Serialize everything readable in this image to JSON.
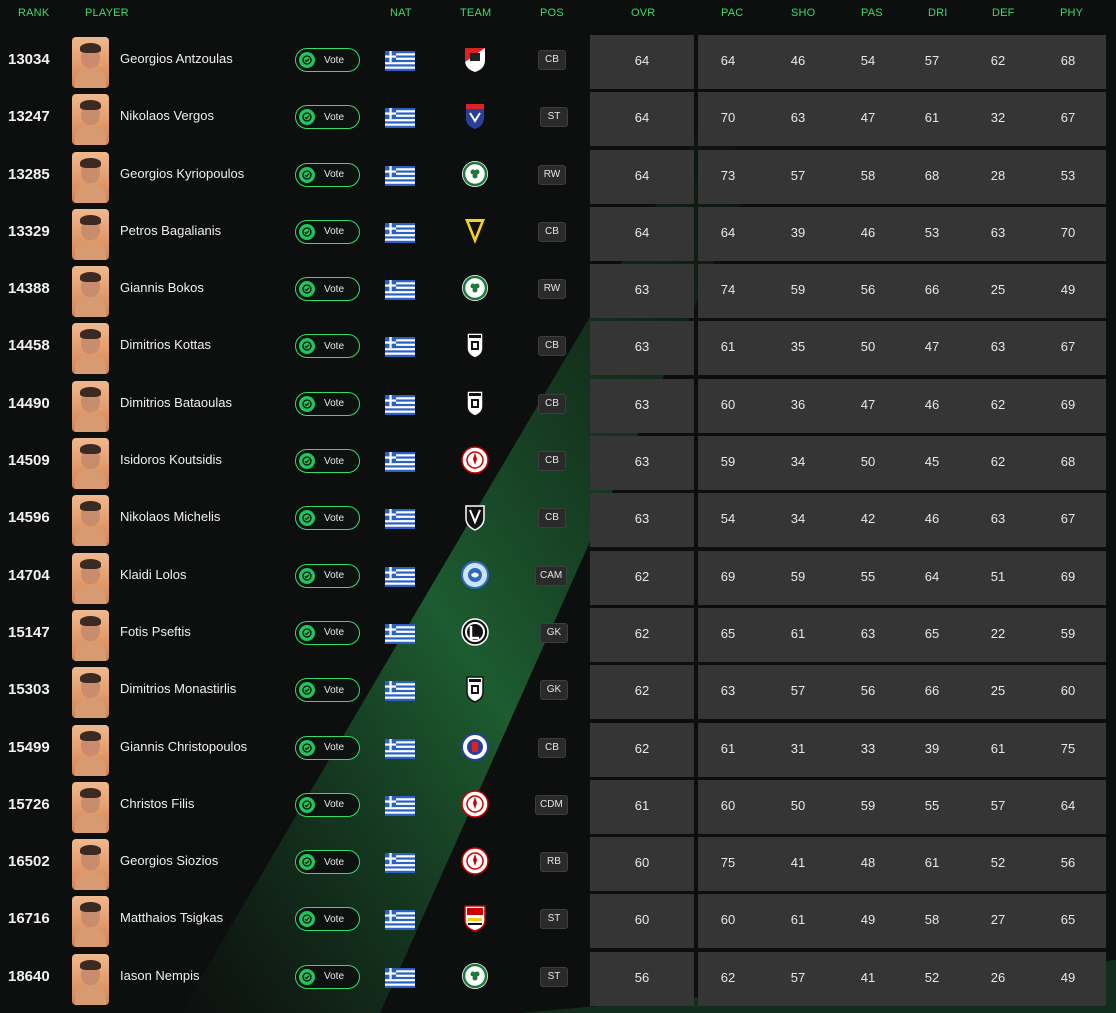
{
  "columns": {
    "rank": "RANK",
    "player": "PLAYER",
    "nat": "NAT",
    "team": "TEAM",
    "pos": "POS",
    "ovr": "OVR",
    "pac": "PAC",
    "sho": "SHO",
    "pas": "PAS",
    "dri": "DRI",
    "def": "DEF",
    "phy": "PHY"
  },
  "vote_label": "Vote",
  "colors": {
    "accent": "#3ddc6a",
    "cell_bg": "#353535",
    "page_bg": "#0d0f0e",
    "card_orange": "#e39b6b"
  },
  "players": [
    {
      "rank": "13034",
      "name": "Georgios Antzoulas",
      "nation": "greece-flag",
      "team": "red-white-shield-crest",
      "pos": "CB",
      "ovr": "64",
      "pac": "64",
      "sho": "46",
      "pas": "54",
      "dri": "57",
      "def": "62",
      "phy": "68"
    },
    {
      "rank": "13247",
      "name": "Nikolaos Vergos",
      "nation": "greece-flag",
      "team": "blue-red-shield-crest",
      "pos": "ST",
      "ovr": "64",
      "pac": "70",
      "sho": "63",
      "pas": "47",
      "dri": "61",
      "def": "32",
      "phy": "67"
    },
    {
      "rank": "13285",
      "name": "Georgios Kyriopoulos",
      "nation": "greece-flag",
      "team": "green-clover-crest",
      "pos": "RW",
      "ovr": "64",
      "pac": "73",
      "sho": "57",
      "pas": "58",
      "dri": "68",
      "def": "28",
      "phy": "53"
    },
    {
      "rank": "13329",
      "name": "Petros Bagalianis",
      "nation": "greece-flag",
      "team": "yellow-black-crest",
      "pos": "CB",
      "ovr": "64",
      "pac": "64",
      "sho": "39",
      "pas": "46",
      "dri": "53",
      "def": "63",
      "phy": "70"
    },
    {
      "rank": "14388",
      "name": "Giannis Bokos",
      "nation": "greece-flag",
      "team": "green-clover-crest",
      "pos": "RW",
      "ovr": "63",
      "pac": "74",
      "sho": "59",
      "pas": "56",
      "dri": "66",
      "def": "25",
      "phy": "49"
    },
    {
      "rank": "14458",
      "name": "Dimitrios Kottas",
      "nation": "greece-flag",
      "team": "black-white-eagle-crest",
      "pos": "CB",
      "ovr": "63",
      "pac": "61",
      "sho": "35",
      "pas": "50",
      "dri": "47",
      "def": "63",
      "phy": "67"
    },
    {
      "rank": "14490",
      "name": "Dimitrios Bataoulas",
      "nation": "greece-flag",
      "team": "black-white-eagle-crest",
      "pos": "CB",
      "ovr": "63",
      "pac": "60",
      "sho": "36",
      "pas": "47",
      "dri": "46",
      "def": "62",
      "phy": "69"
    },
    {
      "rank": "14509",
      "name": "Isidoros Koutsidis",
      "nation": "greece-flag",
      "team": "red-round-crest",
      "pos": "CB",
      "ovr": "63",
      "pac": "59",
      "sho": "34",
      "pas": "50",
      "dri": "45",
      "def": "62",
      "phy": "68"
    },
    {
      "rank": "14596",
      "name": "Nikolaos Michelis",
      "nation": "greece-flag",
      "team": "black-shield-crest",
      "pos": "CB",
      "ovr": "63",
      "pac": "54",
      "sho": "34",
      "pas": "42",
      "dri": "46",
      "def": "63",
      "phy": "67"
    },
    {
      "rank": "14704",
      "name": "Klaidi Lolos",
      "nation": "greece-flag",
      "team": "blue-round-crest",
      "pos": "CAM",
      "ovr": "62",
      "pac": "69",
      "sho": "59",
      "pas": "55",
      "dri": "64",
      "def": "51",
      "phy": "69"
    },
    {
      "rank": "15147",
      "name": "Fotis Pseftis",
      "nation": "greece-flag",
      "team": "black-white-round-crest",
      "pos": "GK",
      "ovr": "62",
      "pac": "65",
      "sho": "61",
      "pas": "63",
      "dri": "65",
      "def": "22",
      "phy": "59"
    },
    {
      "rank": "15303",
      "name": "Dimitrios Monastirlis",
      "nation": "greece-flag",
      "team": "black-white-eagle-crest",
      "pos": "GK",
      "ovr": "62",
      "pac": "63",
      "sho": "57",
      "pas": "56",
      "dri": "66",
      "def": "25",
      "phy": "60"
    },
    {
      "rank": "15499",
      "name": "Giannis Christopoulos",
      "nation": "greece-flag",
      "team": "blue-red-round-crest",
      "pos": "CB",
      "ovr": "62",
      "pac": "61",
      "sho": "31",
      "pas": "33",
      "dri": "39",
      "def": "61",
      "phy": "75"
    },
    {
      "rank": "15726",
      "name": "Christos Filis",
      "nation": "greece-flag",
      "team": "red-round-crest",
      "pos": "CDM",
      "ovr": "61",
      "pac": "60",
      "sho": "50",
      "pas": "59",
      "dri": "55",
      "def": "57",
      "phy": "64"
    },
    {
      "rank": "16502",
      "name": "Georgios Siozios",
      "nation": "greece-flag",
      "team": "red-round-crest",
      "pos": "RB",
      "ovr": "60",
      "pac": "75",
      "sho": "41",
      "pas": "48",
      "dri": "61",
      "def": "52",
      "phy": "56"
    },
    {
      "rank": "16716",
      "name": "Matthaios Tsigkas",
      "nation": "greece-flag",
      "team": "red-yellow-shield-crest",
      "pos": "ST",
      "ovr": "60",
      "pac": "60",
      "sho": "61",
      "pas": "49",
      "dri": "58",
      "def": "27",
      "phy": "65"
    },
    {
      "rank": "18640",
      "name": "Iason Nempis",
      "nation": "greece-flag",
      "team": "green-clover-crest",
      "pos": "ST",
      "ovr": "56",
      "pac": "62",
      "sho": "57",
      "pas": "41",
      "dri": "52",
      "def": "26",
      "phy": "49"
    }
  ]
}
